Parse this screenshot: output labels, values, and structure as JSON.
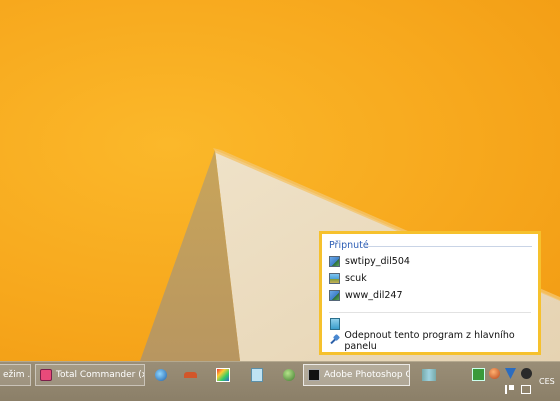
{
  "jumplist": {
    "heading": "Připnuté",
    "items": [
      {
        "label": "swtipy_dil504",
        "icon": "image-file-icon"
      },
      {
        "label": "scuk",
        "icon": "image-file-icon"
      },
      {
        "label": "www_dil247",
        "icon": "image-file-icon"
      }
    ],
    "app_icon": "photoshop-file-icon",
    "unpin_label": "Odepnout tento program z hlavního panelu"
  },
  "taskbar": {
    "buttons": [
      {
        "label": "ežim ...",
        "icon": "app-icon"
      },
      {
        "label": "Total Commander (x...",
        "icon": "total-commander-icon"
      },
      {
        "label": "Adobe Photoshop C...",
        "icon": "photoshop-icon"
      }
    ],
    "pinned_icons": [
      "thunderbird-icon",
      "bridge-icon",
      "image-viewer-icon",
      "files-icon",
      "globe-icon",
      "preview-icon"
    ],
    "tray_icons": [
      "network-monitor-icon",
      "ball-icon",
      "antivirus-icon",
      "audio-icon",
      "flag-icon",
      "network-icon"
    ],
    "language": "CES"
  },
  "colors": {
    "desktop": "#f7a81d",
    "taskbar": "#8b7f68",
    "jumplist_border": "#f6c12d",
    "heading": "#2e5fb5"
  }
}
